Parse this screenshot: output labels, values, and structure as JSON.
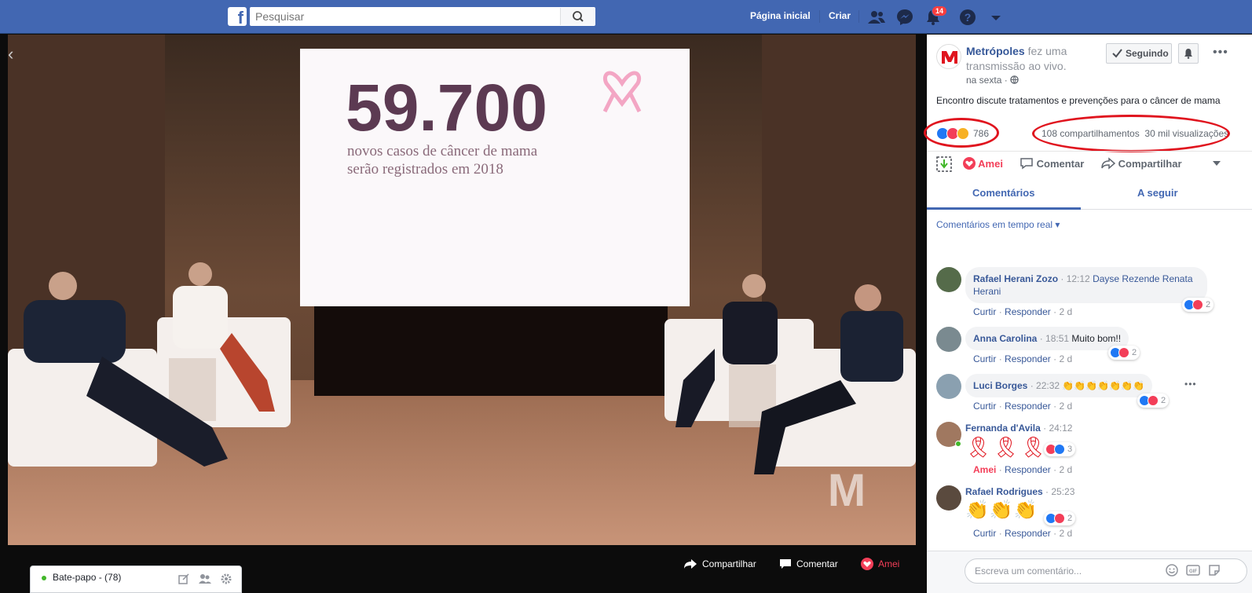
{
  "topbar": {
    "logo": "f",
    "search_placeholder": "Pesquisar",
    "nav_home": "Página inicial",
    "nav_create": "Criar",
    "notifications_count": "14",
    "icons": [
      "friends-icon",
      "messenger-icon",
      "notifications-icon",
      "help-icon",
      "caret-down-icon"
    ]
  },
  "video": {
    "slide_number": "59.700",
    "slide_caption_line1": "novos casos de câncer de mama",
    "slide_caption_line2": "serão registrados em 2018",
    "watermark": "M",
    "actions": {
      "share": "Compartilhar",
      "comment": "Comentar",
      "love": "Amei"
    }
  },
  "chat": {
    "label": "Bate-papo - (78)"
  },
  "post": {
    "page_name": "Metrópoles",
    "action_text": " fez uma transmissão ao vivo.",
    "time": "na sexta ·",
    "follow_label": "Seguindo",
    "text": "Encontro discute tratamentos e prevenções para o câncer de mama",
    "reactions_count": "786",
    "shares": "108 compartilhamentos",
    "views": "30 mil visualizações",
    "action_love": "Amei",
    "action_comment": "Comentar",
    "action_share": "Compartilhar",
    "tab_comments": "Comentários",
    "tab_following": "A seguir",
    "realtime_label": "Comentários em tempo real ▾"
  },
  "comments": [
    {
      "name": "Rafael Herani Zozo",
      "time": "· 12:12",
      "text": "Dayse Rezende Renata Herani",
      "like": "Curtir",
      "reply": "Responder",
      "ago": "2 d",
      "reactions": "2"
    },
    {
      "name": "Anna Carolina",
      "time": "· 18:51",
      "text": "Muito bom!!",
      "like": "Curtir",
      "reply": "Responder",
      "ago": "2 d",
      "reactions": "2"
    },
    {
      "name": "Luci Borges",
      "time": "· 22:32",
      "text": "👏👏👏👏👏👏👏",
      "like": "Curtir",
      "reply": "Responder",
      "ago": "2 d",
      "reactions": "2"
    },
    {
      "name": "Fernanda d'Avila",
      "time": "· 24:12",
      "text": "🎗🎗🎗",
      "like": "Amei",
      "reply": "Responder",
      "ago": "2 d",
      "reactions": "3"
    },
    {
      "name": "Rafael Rodrigues",
      "time": "· 25:23",
      "text": "👏👏👏",
      "like": "Curtir",
      "reply": "Responder",
      "ago": "2 d",
      "reactions": "2"
    }
  ],
  "compose": {
    "placeholder": "Escreva um comentário..."
  },
  "colors": {
    "facebook_blue": "#4267b2",
    "love_red": "#f33e58",
    "annotation_red": "#e0141e"
  }
}
